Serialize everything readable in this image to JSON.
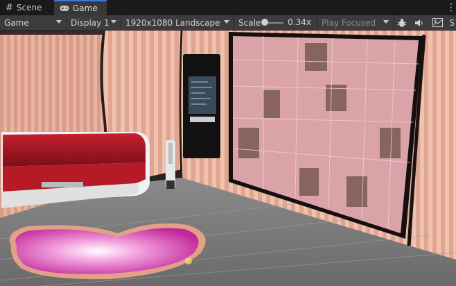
{
  "tabs": [
    {
      "label": "Scene",
      "icon": "hash-icon",
      "active": false
    },
    {
      "label": "Game",
      "icon": "gamepad-icon",
      "active": true
    }
  ],
  "toolbar": {
    "view_mode": "Game",
    "display": "Display 1",
    "resolution": "1920x1080 Landscape",
    "scale_label": "Scale",
    "scale_value": "0.34x",
    "scale_fraction": 0.1,
    "play_mode": "Play Focused",
    "overflow_label": "S"
  },
  "colors": {
    "accent": "#3a79d8",
    "toolbar_bg": "#3c3c3c",
    "tabbar_bg": "#1a1a1a"
  }
}
